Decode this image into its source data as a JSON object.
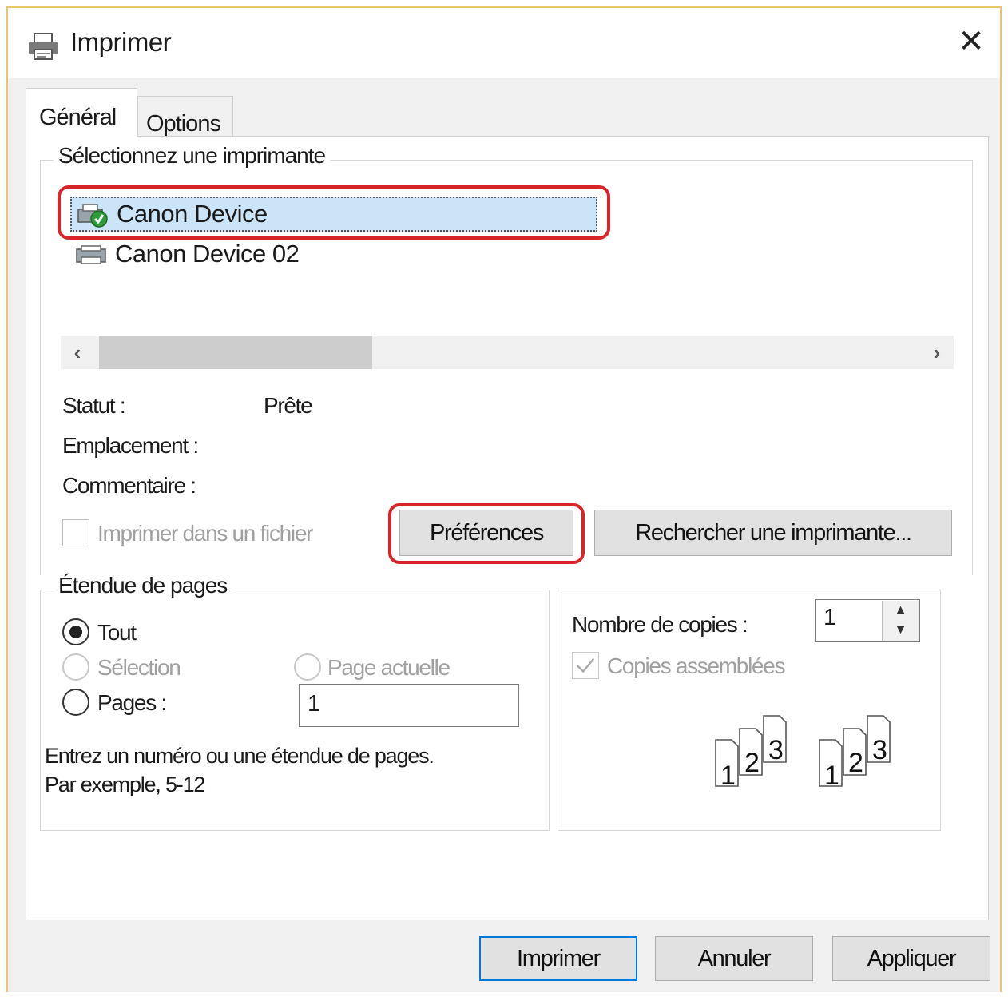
{
  "window": {
    "title": "Imprimer",
    "close_glyph": "✕"
  },
  "tabs": [
    {
      "label": "Général",
      "active": true
    },
    {
      "label": "Options",
      "active": false
    }
  ],
  "printer_group": {
    "legend": "Sélectionnez une imprimante",
    "printers": [
      {
        "name": "Canon Device",
        "selected": true,
        "icon": "printer-default-icon"
      },
      {
        "name": "Canon Device 02",
        "selected": false,
        "icon": "printer-icon"
      }
    ],
    "scroll_left": "‹",
    "scroll_right": "›",
    "status_label": "Statut :",
    "status_value": "Prête",
    "location_label": "Emplacement :",
    "comment_label": "Commentaire :",
    "print_to_file_label": "Imprimer dans un fichier",
    "preferences_button": "Préférences",
    "find_printer_button": "Rechercher une imprimante..."
  },
  "page_range": {
    "legend": "Étendue de pages",
    "options": {
      "all": "Tout",
      "selection": "Sélection",
      "current_page": "Page actuelle",
      "pages": "Pages :"
    },
    "selected": "all",
    "pages_value": "1",
    "hint_line1": "Entrez un numéro ou une étendue de pages.",
    "hint_line2": "Par exemple, 5-12"
  },
  "copies": {
    "label": "Nombre de copies :",
    "value": "1",
    "collate_label": "Copies assemblées",
    "collate_checked": true,
    "collate_pages": [
      "1",
      "2",
      "3"
    ]
  },
  "footer": {
    "print_button": "Imprimer",
    "cancel_button": "Annuler",
    "apply_button": "Appliquer"
  },
  "colors": {
    "highlight": "#d9252a",
    "selection": "#cce4f7",
    "focus_border": "#0078d7"
  }
}
